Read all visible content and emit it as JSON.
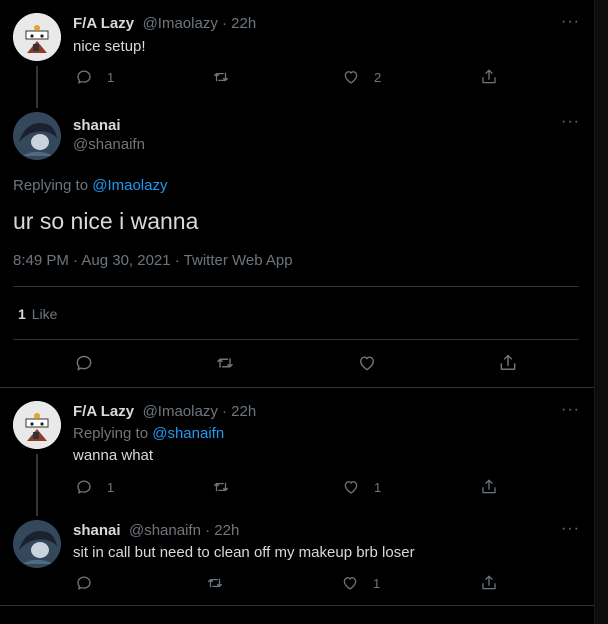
{
  "tweet1": {
    "name": "F/A Lazy",
    "meta": "@Imaolazy · 22h",
    "text": "nice setup!",
    "replies": "1",
    "likes": "2"
  },
  "main": {
    "name": "shanai",
    "handle": "@shanaifn",
    "replying_prefix": "Replying to ",
    "replying_handle": "@Imaolazy",
    "text": "ur so nice i wanna",
    "timestamp": "8:49 PM · Aug 30, 2021 · Twitter Web App",
    "like_count": "1",
    "like_label": "Like"
  },
  "tweet3": {
    "name": "F/A Lazy",
    "meta": "@Imaolazy · 22h",
    "replying_prefix": "Replying to ",
    "replying_handle": "@shanaifn",
    "text": "wanna what",
    "replies": "1",
    "likes": "1"
  },
  "tweet4": {
    "name": "shanai",
    "meta": "@shanaifn · 22h",
    "text": "sit in call but need to clean off my makeup brb loser",
    "likes": "1"
  },
  "icons": {
    "reply": "reply-icon",
    "retweet": "retweet-icon",
    "like": "heart-icon",
    "share": "share-icon",
    "more": "more-icon"
  },
  "colors": {
    "background": "#000000",
    "link": "#1d9bf0",
    "muted": "#6e767d",
    "text": "#d9d9d9",
    "divider": "#2f3336"
  }
}
